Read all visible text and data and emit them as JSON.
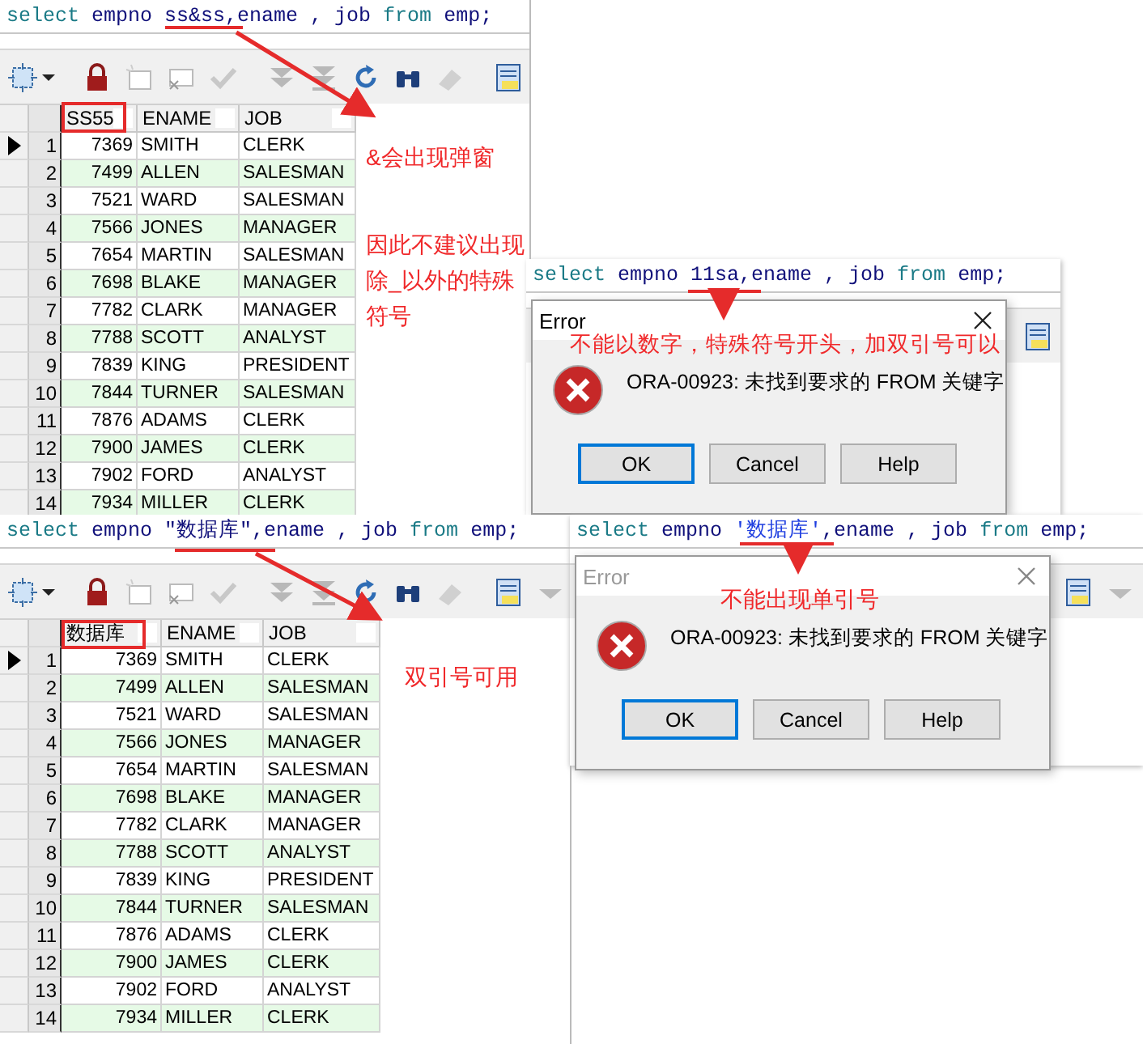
{
  "panels": [
    {
      "kind": "results",
      "sql": [
        {
          "text": "select",
          "kind": "keyword"
        },
        {
          "text": " empno ss&ss,ename , job ",
          "kind": "plain"
        },
        {
          "text": "from",
          "kind": "keyword"
        },
        {
          "text": " emp;",
          "kind": "plain"
        }
      ],
      "columns": [
        "SS55",
        "ENAME",
        "JOB"
      ],
      "rows": [
        {
          "number": "1",
          "current": true,
          "cells": [
            "7369",
            "SMITH",
            "CLERK"
          ]
        },
        {
          "number": "2",
          "current": false,
          "cells": [
            "7499",
            "ALLEN",
            "SALESMAN"
          ]
        },
        {
          "number": "3",
          "current": false,
          "cells": [
            "7521",
            "WARD",
            "SALESMAN"
          ]
        },
        {
          "number": "4",
          "current": false,
          "cells": [
            "7566",
            "JONES",
            "MANAGER"
          ]
        },
        {
          "number": "5",
          "current": false,
          "cells": [
            "7654",
            "MARTIN",
            "SALESMAN"
          ]
        },
        {
          "number": "6",
          "current": false,
          "cells": [
            "7698",
            "BLAKE",
            "MANAGER"
          ]
        },
        {
          "number": "7",
          "current": false,
          "cells": [
            "7782",
            "CLARK",
            "MANAGER"
          ]
        },
        {
          "number": "8",
          "current": false,
          "cells": [
            "7788",
            "SCOTT",
            "ANALYST"
          ]
        },
        {
          "number": "9",
          "current": false,
          "cells": [
            "7839",
            "KING",
            "PRESIDENT"
          ]
        },
        {
          "number": "10",
          "current": false,
          "cells": [
            "7844",
            "TURNER",
            "SALESMAN"
          ]
        },
        {
          "number": "11",
          "current": false,
          "cells": [
            "7876",
            "ADAMS",
            "CLERK"
          ]
        },
        {
          "number": "12",
          "current": false,
          "cells": [
            "7900",
            "JAMES",
            "CLERK"
          ]
        },
        {
          "number": "13",
          "current": false,
          "cells": [
            "7902",
            "FORD",
            "ANALYST"
          ]
        },
        {
          "number": "14",
          "current": false,
          "cells": [
            "7934",
            "MILLER",
            "CLERK"
          ]
        }
      ],
      "notes": [
        "&会出现弹窗",
        "因此不建议出现除_以外的特殊符号"
      ]
    },
    {
      "kind": "error",
      "sql": [
        {
          "text": "select",
          "kind": "keyword"
        },
        {
          "text": " empno 11sa,ename , job ",
          "kind": "plain"
        },
        {
          "text": "from",
          "kind": "keyword"
        },
        {
          "text": " emp;",
          "kind": "plain"
        }
      ],
      "dialog": {
        "title": "Error",
        "active": true,
        "message": "ORA-00923: 未找到要求的 FROM 关键字",
        "buttons": [
          {
            "label": "OK",
            "selected": true
          },
          {
            "label": "Cancel",
            "selected": false
          },
          {
            "label": "Help",
            "selected": false
          }
        ]
      },
      "notes": [
        "不能以数字，特殊符号开头，加双引号可以"
      ]
    },
    {
      "kind": "results",
      "sql": [
        {
          "text": "select",
          "kind": "keyword"
        },
        {
          "text": " empno \"数据库\",ename , job ",
          "kind": "plain"
        },
        {
          "text": "from",
          "kind": "keyword"
        },
        {
          "text": " emp;",
          "kind": "plain"
        }
      ],
      "columns": [
        "数据库",
        "ENAME",
        "JOB"
      ],
      "rows": [
        {
          "number": "1",
          "current": true,
          "cells": [
            "7369",
            "SMITH",
            "CLERK"
          ]
        },
        {
          "number": "2",
          "current": false,
          "cells": [
            "7499",
            "ALLEN",
            "SALESMAN"
          ]
        },
        {
          "number": "3",
          "current": false,
          "cells": [
            "7521",
            "WARD",
            "SALESMAN"
          ]
        },
        {
          "number": "4",
          "current": false,
          "cells": [
            "7566",
            "JONES",
            "MANAGER"
          ]
        },
        {
          "number": "5",
          "current": false,
          "cells": [
            "7654",
            "MARTIN",
            "SALESMAN"
          ]
        },
        {
          "number": "6",
          "current": false,
          "cells": [
            "7698",
            "BLAKE",
            "MANAGER"
          ]
        },
        {
          "number": "7",
          "current": false,
          "cells": [
            "7782",
            "CLARK",
            "MANAGER"
          ]
        },
        {
          "number": "8",
          "current": false,
          "cells": [
            "7788",
            "SCOTT",
            "ANALYST"
          ]
        },
        {
          "number": "9",
          "current": false,
          "cells": [
            "7839",
            "KING",
            "PRESIDENT"
          ]
        },
        {
          "number": "10",
          "current": false,
          "cells": [
            "7844",
            "TURNER",
            "SALESMAN"
          ]
        },
        {
          "number": "11",
          "current": false,
          "cells": [
            "7876",
            "ADAMS",
            "CLERK"
          ]
        },
        {
          "number": "12",
          "current": false,
          "cells": [
            "7900",
            "JAMES",
            "CLERK"
          ]
        },
        {
          "number": "13",
          "current": false,
          "cells": [
            "7902",
            "FORD",
            "ANALYST"
          ]
        },
        {
          "number": "14",
          "current": false,
          "cells": [
            "7934",
            "MILLER",
            "CLERK"
          ]
        }
      ],
      "notes": [
        "双引号可用"
      ]
    },
    {
      "kind": "error",
      "sql": [
        {
          "text": "select",
          "kind": "keyword"
        },
        {
          "text": " empno ",
          "kind": "plain"
        },
        {
          "text": "'数据库'",
          "kind": "string"
        },
        {
          "text": ",ename , job ",
          "kind": "plain"
        },
        {
          "text": "from",
          "kind": "keyword"
        },
        {
          "text": " emp;",
          "kind": "plain"
        }
      ],
      "dialog": {
        "title": "Error",
        "active": false,
        "message": "ORA-00923: 未找到要求的 FROM 关键字",
        "buttons": [
          {
            "label": "OK",
            "selected": true
          },
          {
            "label": "Cancel",
            "selected": false
          },
          {
            "label": "Help",
            "selected": false
          }
        ]
      },
      "notes": [
        "不能出现单引号"
      ]
    }
  ]
}
